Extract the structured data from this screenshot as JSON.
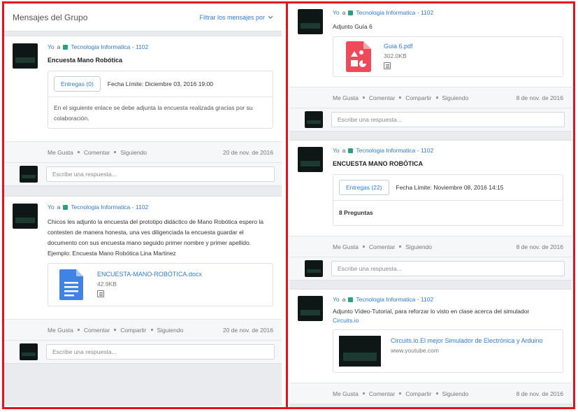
{
  "header": {
    "title": "Mensajes del Grupo",
    "filter_label": "Filtrar los mensajes por"
  },
  "common": {
    "sender": "Yo",
    "to": "a",
    "group": "Tecnologia Informatica - 1102",
    "like": "Me Gusta",
    "comment": "Comentar",
    "share": "Compartir",
    "follow": "Siguiendo",
    "reply_placeholder": "Escribe una respuesta..."
  },
  "left_posts": [
    {
      "title": "Encuesta Mano Robótica",
      "submissions": "Entregas (0)",
      "deadline": "Fecha Límite: Diciembre 03, 2016 19:00",
      "description": "En el siguiente enlace se debe adjunta la encuesta realizada gracias por su colaboración.",
      "date": "20 de nov. de 2016"
    },
    {
      "text": "Chicos les adjunto la encuesta del prototipo didáctico de Mano Robótica espero la contesten de manera honesta, una ves diligenciada la encuesta guardar el documento con sus encuesta mano seguido primer nombre y primer apellido. Ejemplo: Encuesta Mano Robótica Lina Martinez",
      "attachment_name": "ENCUESTA-MANO-ROBÓTICA.docx",
      "attachment_size": "42.9KB",
      "date": "20 de nov. de 2016"
    }
  ],
  "right_posts": [
    {
      "text": "Adjunto Guía 6",
      "attachment_name": "Guia 6.pdf",
      "attachment_size": "302.0KB",
      "date": "8 de nov. de 2016"
    },
    {
      "title": "ENCUESTA MANO ROBÓTICA",
      "submissions": "Entregas (22)",
      "deadline": "Fecha Límite: Noviembre 08, 2016 14:15",
      "questions": "8 Preguntas",
      "date": "8 de nov. de 2016"
    },
    {
      "text": "Adjunto Vídeo-Tutorial, para reforzar lo visto en clase acerca del simulador",
      "link_text": "Circuits.io",
      "video_title": "Circuits.io.El mejor Simulador de Electrónica y Arduino",
      "video_source": "www.youtube.com",
      "date": "8 de nov. de 2016"
    }
  ],
  "colors": {
    "accent": "#2f7bd8",
    "group_badge": "#26a17b",
    "highlight_frame": "#e8101b",
    "pdf_icon": "#ef4a5a",
    "doc_icon": "#3f84e5"
  }
}
